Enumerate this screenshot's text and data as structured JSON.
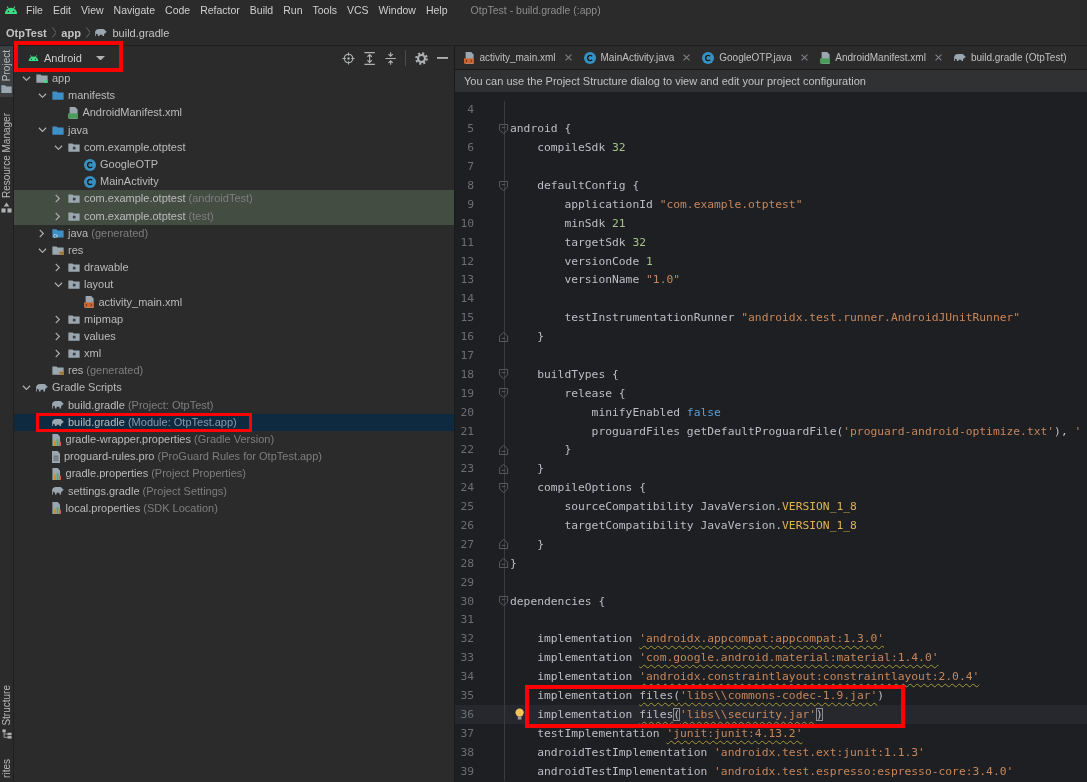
{
  "menu_bar": {
    "items": [
      "File",
      "Edit",
      "View",
      "Navigate",
      "Code",
      "Refactor",
      "Build",
      "Run",
      "Tools",
      "VCS",
      "Window",
      "Help"
    ],
    "title": "OtpTest - build.gradle (:app)"
  },
  "breadcrumbs": [
    {
      "label": "OtpTest",
      "kind": "folder"
    },
    {
      "label": "app",
      "kind": "folder"
    },
    {
      "label": "build.gradle",
      "kind": "script"
    }
  ],
  "tool_windows": {
    "top": [
      {
        "label": "Project",
        "kind": "project",
        "selected": true
      },
      {
        "label": "Resource Manager",
        "kind": "resources",
        "selected": false
      }
    ],
    "bottom": [
      {
        "label": "Structure",
        "kind": "structure",
        "selected": false
      },
      {
        "label": "rites",
        "selected": false
      }
    ]
  },
  "project_panel": {
    "view_dropdown": {
      "label": "Android",
      "annotated": true
    },
    "tree": [
      {
        "label": "app",
        "kind": "module",
        "expanded": true,
        "selected": false,
        "tinted": false,
        "annotated": false,
        "children": [
          {
            "label": "manifests",
            "kind": "folder",
            "expanded": true,
            "selected": false,
            "tinted": false,
            "annotated": false,
            "children": [
              {
                "label": "AndroidManifest.xml",
                "kind": "manifest",
                "selected": false,
                "tinted": false,
                "annotated": false
              }
            ]
          },
          {
            "label": "java",
            "kind": "folder",
            "expanded": true,
            "selected": false,
            "tinted": false,
            "annotated": false,
            "children": [
              {
                "label": "com.example.otptest",
                "kind": "package",
                "expanded": true,
                "selected": false,
                "tinted": false,
                "annotated": false,
                "children": [
                  {
                    "label": "GoogleOTP",
                    "kind": "class",
                    "selected": false,
                    "tinted": false,
                    "annotated": false
                  },
                  {
                    "label": "MainActivity",
                    "kind": "class",
                    "selected": false,
                    "tinted": false,
                    "annotated": false
                  }
                ]
              },
              {
                "label": "com.example.otptest",
                "note": "(androidTest)",
                "kind": "package",
                "expanded": false,
                "selected": false,
                "tinted": true,
                "annotated": false
              },
              {
                "label": "com.example.otptest",
                "note": "(test)",
                "kind": "package",
                "expanded": false,
                "selected": false,
                "tinted": true,
                "annotated": false
              }
            ]
          },
          {
            "label": "java",
            "note": "(generated)",
            "kind": "generated",
            "expanded": false,
            "selected": false,
            "tinted": false,
            "annotated": false
          },
          {
            "label": "res",
            "kind": "resources",
            "expanded": true,
            "selected": false,
            "tinted": false,
            "annotated": false,
            "children": [
              {
                "label": "drawable",
                "kind": "package",
                "expanded": false,
                "selected": false,
                "tinted": false,
                "annotated": false
              },
              {
                "label": "layout",
                "kind": "package",
                "expanded": true,
                "selected": false,
                "tinted": false,
                "annotated": false,
                "children": [
                  {
                    "label": "activity_main.xml",
                    "kind": "layout",
                    "selected": false,
                    "tinted": false,
                    "annotated": false
                  }
                ]
              },
              {
                "label": "mipmap",
                "kind": "package",
                "expanded": false,
                "selected": false,
                "tinted": false,
                "annotated": false
              },
              {
                "label": "values",
                "kind": "package",
                "expanded": false,
                "selected": false,
                "tinted": false,
                "annotated": false
              },
              {
                "label": "xml",
                "kind": "package",
                "expanded": false,
                "selected": false,
                "tinted": false,
                "annotated": false
              }
            ]
          },
          {
            "label": "res",
            "note": "(generated)",
            "kind": "resources",
            "selected": false,
            "tinted": false,
            "annotated": false
          }
        ]
      },
      {
        "label": "Gradle Scripts",
        "kind": "script",
        "expanded": true,
        "selected": false,
        "tinted": false,
        "annotated": false,
        "children": [
          {
            "label": "build.gradle",
            "note": "(Project: OtpTest)",
            "kind": "script",
            "selected": false,
            "tinted": false,
            "annotated": false
          },
          {
            "label": "build.gradle",
            "note": "(Module: OtpTest.app)",
            "kind": "script",
            "selected": true,
            "tinted": false,
            "annotated": true
          },
          {
            "label": "gradle-wrapper.properties",
            "note": "(Gradle Version)",
            "kind": "properties",
            "selected": false,
            "tinted": false,
            "annotated": false
          },
          {
            "label": "proguard-rules.pro",
            "note": "(ProGuard Rules for OtpTest.app)",
            "kind": "file",
            "selected": false,
            "tinted": false,
            "annotated": false
          },
          {
            "label": "gradle.properties",
            "note": "(Project Properties)",
            "kind": "properties",
            "selected": false,
            "tinted": false,
            "annotated": false
          },
          {
            "label": "settings.gradle",
            "note": "(Project Settings)",
            "kind": "script",
            "selected": false,
            "tinted": false,
            "annotated": false
          },
          {
            "label": "local.properties",
            "note": "(SDK Location)",
            "kind": "properties",
            "selected": false,
            "tinted": false,
            "annotated": false
          }
        ]
      }
    ]
  },
  "editor": {
    "tabs": [
      {
        "label": "activity_main.xml",
        "kind": "layout",
        "selected": false,
        "closable": true
      },
      {
        "label": "MainActivity.java",
        "kind": "class",
        "selected": false,
        "closable": true
      },
      {
        "label": "GoogleOTP.java",
        "kind": "class",
        "selected": false,
        "closable": true
      },
      {
        "label": "AndroidManifest.xml",
        "kind": "manifest",
        "selected": false,
        "closable": true
      },
      {
        "label": "build.gradle (OtpTest)",
        "kind": "script",
        "selected": false,
        "closable": false
      }
    ],
    "notification": "You can use the Project Structure dialog to view and edit your project configuration",
    "lines": [
      {
        "number": "4"
      },
      {
        "number": "5",
        "fold_start": true,
        "tokens": [
          {
            "text": "android {",
            "kind": "plain"
          }
        ]
      },
      {
        "number": "6",
        "tokens": [
          {
            "text": "    compileSdk ",
            "kind": "plain"
          },
          {
            "text": "32",
            "kind": "number"
          }
        ]
      },
      {
        "number": "7"
      },
      {
        "number": "8",
        "fold_start": true,
        "tokens": [
          {
            "text": "    defaultConfig {",
            "kind": "plain"
          }
        ]
      },
      {
        "number": "9",
        "tokens": [
          {
            "text": "        applicationId ",
            "kind": "plain"
          },
          {
            "text": "\"com.example.otptest\"",
            "kind": "string"
          }
        ]
      },
      {
        "number": "10",
        "tokens": [
          {
            "text": "        minSdk ",
            "kind": "plain"
          },
          {
            "text": "21",
            "kind": "number"
          }
        ]
      },
      {
        "number": "11",
        "tokens": [
          {
            "text": "        targetSdk ",
            "kind": "plain"
          },
          {
            "text": "32",
            "kind": "number"
          }
        ]
      },
      {
        "number": "12",
        "tokens": [
          {
            "text": "        versionCode ",
            "kind": "plain"
          },
          {
            "text": "1",
            "kind": "number"
          }
        ]
      },
      {
        "number": "13",
        "tokens": [
          {
            "text": "        versionName ",
            "kind": "plain"
          },
          {
            "text": "\"1.0\"",
            "kind": "string"
          }
        ]
      },
      {
        "number": "14"
      },
      {
        "number": "15",
        "tokens": [
          {
            "text": "        testInstrumentationRunner ",
            "kind": "plain"
          },
          {
            "text": "\"androidx.test.runner.AndroidJUnitRunner\"",
            "kind": "string"
          }
        ]
      },
      {
        "number": "16",
        "fold_end": true,
        "tokens": [
          {
            "text": "    }",
            "kind": "plain"
          }
        ]
      },
      {
        "number": "17"
      },
      {
        "number": "18",
        "fold_start": true,
        "tokens": [
          {
            "text": "    buildTypes {",
            "kind": "plain"
          }
        ]
      },
      {
        "number": "19",
        "fold_start": true,
        "tokens": [
          {
            "text": "        release {",
            "kind": "plain"
          }
        ]
      },
      {
        "number": "20",
        "tokens": [
          {
            "text": "            minifyEnabled ",
            "kind": "plain"
          },
          {
            "text": "false",
            "kind": "keyword"
          }
        ]
      },
      {
        "number": "21",
        "tokens": [
          {
            "text": "            proguardFiles getDefaultProguardFile(",
            "kind": "plain"
          },
          {
            "text": "'proguard-android-optimize.txt'",
            "kind": "string"
          },
          {
            "text": "), ",
            "kind": "plain"
          },
          {
            "text": "'",
            "kind": "string"
          }
        ]
      },
      {
        "number": "22",
        "fold_end": true,
        "tokens": [
          {
            "text": "        }",
            "kind": "plain"
          }
        ]
      },
      {
        "number": "23",
        "fold_end": true,
        "tokens": [
          {
            "text": "    }",
            "kind": "plain"
          }
        ]
      },
      {
        "number": "24",
        "fold_start": true,
        "tokens": [
          {
            "text": "    compileOptions {",
            "kind": "plain"
          }
        ]
      },
      {
        "number": "25",
        "tokens": [
          {
            "text": "        sourceCompatibility JavaVersion.",
            "kind": "plain"
          },
          {
            "text": "VERSION_1_8",
            "kind": "constant"
          }
        ]
      },
      {
        "number": "26",
        "tokens": [
          {
            "text": "        targetCompatibility JavaVersion.",
            "kind": "plain"
          },
          {
            "text": "VERSION_1_8",
            "kind": "constant"
          }
        ]
      },
      {
        "number": "27",
        "fold_end": true,
        "tokens": [
          {
            "text": "    }",
            "kind": "plain"
          }
        ]
      },
      {
        "number": "28",
        "fold_end": true,
        "tokens": [
          {
            "text": "}",
            "kind": "plain"
          }
        ]
      },
      {
        "number": "29"
      },
      {
        "number": "30",
        "fold_start": true,
        "tokens": [
          {
            "text": "dependencies {",
            "kind": "plain"
          }
        ]
      },
      {
        "number": "31"
      },
      {
        "number": "32",
        "tokens": [
          {
            "text": "    implementation ",
            "kind": "plain"
          },
          {
            "text": "'androidx.appcompat:appcompat:1.3.0'",
            "kind": "string",
            "warning": true
          }
        ]
      },
      {
        "number": "33",
        "tokens": [
          {
            "text": "    implementation ",
            "kind": "plain"
          },
          {
            "text": "'com.google.android.material:material:1.4.0'",
            "kind": "string",
            "warning": true
          }
        ]
      },
      {
        "number": "34",
        "tokens": [
          {
            "text": "    implementation ",
            "kind": "plain"
          },
          {
            "text": "'androidx.constraintlayout:constraintlayout:2.0.4'",
            "kind": "string",
            "warning": true
          }
        ]
      },
      {
        "number": "35",
        "marked": true,
        "tokens": [
          {
            "text": "    implementation ",
            "kind": "plain"
          },
          {
            "text": "files(",
            "kind": "plain",
            "warning": true
          },
          {
            "text": "'libs\\\\commons-codec-1.9.jar'",
            "kind": "string",
            "warning": true
          },
          {
            "text": ")",
            "kind": "plain"
          }
        ]
      },
      {
        "number": "36",
        "marked": true,
        "current": true,
        "bulb": true,
        "tokens": [
          {
            "text": "    implementation ",
            "kind": "plain"
          },
          {
            "text": "files",
            "kind": "plain",
            "warning": true
          },
          {
            "text": "(",
            "kind": "plain",
            "matched": true
          },
          {
            "text": "'libs\\\\security.jar'",
            "kind": "string",
            "warning": true
          },
          {
            "text": ")",
            "kind": "plain",
            "matched": true
          }
        ]
      },
      {
        "number": "37",
        "tokens": [
          {
            "text": "    testImplementation ",
            "kind": "plain"
          },
          {
            "text": "'junit:junit:4.13.2'",
            "kind": "string",
            "warning": true
          }
        ]
      },
      {
        "number": "38",
        "tokens": [
          {
            "text": "    androidTestImplementation ",
            "kind": "plain"
          },
          {
            "text": "'androidx.test.ext:junit:1.1.3'",
            "kind": "string"
          }
        ]
      },
      {
        "number": "39",
        "tokens": [
          {
            "text": "    androidTestImplementation ",
            "kind": "plain"
          },
          {
            "text": "'androidx.test.espresso:espresso-core:3.4.0'",
            "kind": "string"
          }
        ]
      }
    ]
  }
}
